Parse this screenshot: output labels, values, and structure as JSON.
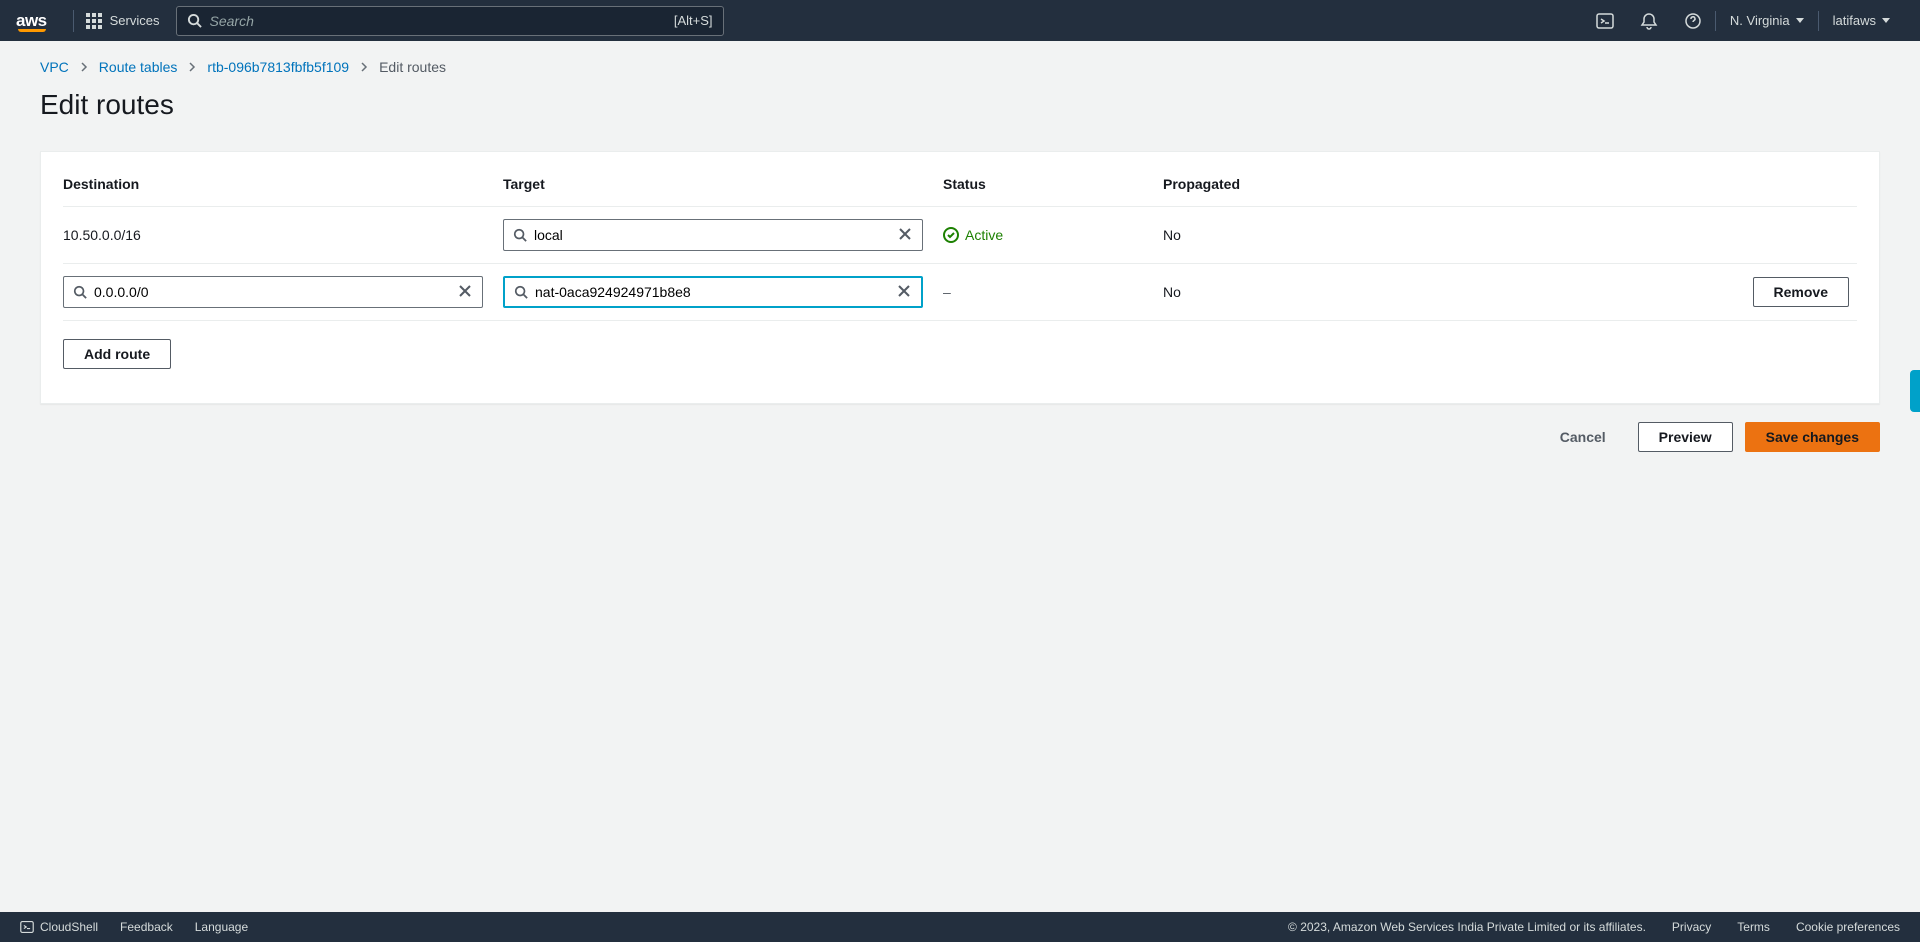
{
  "topbar": {
    "logo": "aws",
    "services_label": "Services",
    "search_placeholder": "Search",
    "search_shortcut": "[Alt+S]",
    "region": "N. Virginia",
    "user": "latifaws"
  },
  "breadcrumbs": {
    "items": [
      "VPC",
      "Route tables",
      "rtb-096b7813fbfb5f109"
    ],
    "current": "Edit routes"
  },
  "page": {
    "title": "Edit routes"
  },
  "table": {
    "headers": {
      "destination": "Destination",
      "target": "Target",
      "status": "Status",
      "propagated": "Propagated"
    },
    "row0": {
      "destination": "10.50.0.0/16",
      "target": "local",
      "status": "Active",
      "propagated": "No"
    },
    "row1": {
      "destination": "0.0.0.0/0",
      "target": "nat-0aca924924971b8e8",
      "status": "–",
      "propagated": "No",
      "remove_label": "Remove"
    },
    "add_route_label": "Add route"
  },
  "actions": {
    "cancel": "Cancel",
    "preview": "Preview",
    "save": "Save changes"
  },
  "footer": {
    "cloudshell": "CloudShell",
    "feedback": "Feedback",
    "language": "Language",
    "copyright": "© 2023, Amazon Web Services India Private Limited or its affiliates.",
    "privacy": "Privacy",
    "terms": "Terms",
    "cookies": "Cookie preferences"
  }
}
